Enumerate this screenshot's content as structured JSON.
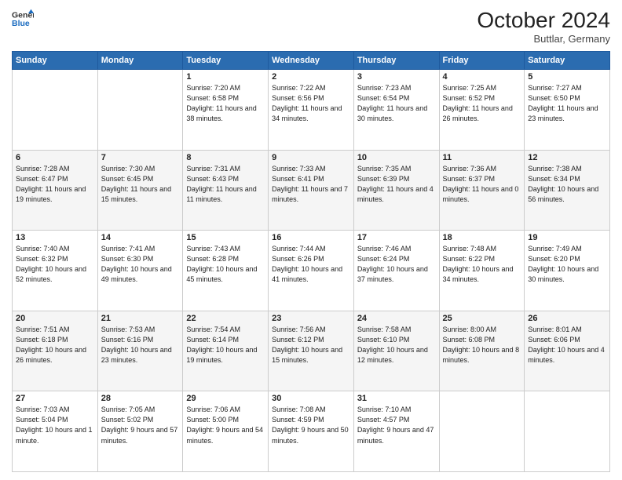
{
  "header": {
    "logo": {
      "general": "General",
      "blue": "Blue"
    },
    "title": "October 2024",
    "location": "Buttlar, Germany"
  },
  "calendar": {
    "days_of_week": [
      "Sunday",
      "Monday",
      "Tuesday",
      "Wednesday",
      "Thursday",
      "Friday",
      "Saturday"
    ],
    "weeks": [
      [
        {
          "day": "",
          "sunrise": "",
          "sunset": "",
          "daylight": ""
        },
        {
          "day": "",
          "sunrise": "",
          "sunset": "",
          "daylight": ""
        },
        {
          "day": "1",
          "sunrise": "Sunrise: 7:20 AM",
          "sunset": "Sunset: 6:58 PM",
          "daylight": "Daylight: 11 hours and 38 minutes."
        },
        {
          "day": "2",
          "sunrise": "Sunrise: 7:22 AM",
          "sunset": "Sunset: 6:56 PM",
          "daylight": "Daylight: 11 hours and 34 minutes."
        },
        {
          "day": "3",
          "sunrise": "Sunrise: 7:23 AM",
          "sunset": "Sunset: 6:54 PM",
          "daylight": "Daylight: 11 hours and 30 minutes."
        },
        {
          "day": "4",
          "sunrise": "Sunrise: 7:25 AM",
          "sunset": "Sunset: 6:52 PM",
          "daylight": "Daylight: 11 hours and 26 minutes."
        },
        {
          "day": "5",
          "sunrise": "Sunrise: 7:27 AM",
          "sunset": "Sunset: 6:50 PM",
          "daylight": "Daylight: 11 hours and 23 minutes."
        }
      ],
      [
        {
          "day": "6",
          "sunrise": "Sunrise: 7:28 AM",
          "sunset": "Sunset: 6:47 PM",
          "daylight": "Daylight: 11 hours and 19 minutes."
        },
        {
          "day": "7",
          "sunrise": "Sunrise: 7:30 AM",
          "sunset": "Sunset: 6:45 PM",
          "daylight": "Daylight: 11 hours and 15 minutes."
        },
        {
          "day": "8",
          "sunrise": "Sunrise: 7:31 AM",
          "sunset": "Sunset: 6:43 PM",
          "daylight": "Daylight: 11 hours and 11 minutes."
        },
        {
          "day": "9",
          "sunrise": "Sunrise: 7:33 AM",
          "sunset": "Sunset: 6:41 PM",
          "daylight": "Daylight: 11 hours and 7 minutes."
        },
        {
          "day": "10",
          "sunrise": "Sunrise: 7:35 AM",
          "sunset": "Sunset: 6:39 PM",
          "daylight": "Daylight: 11 hours and 4 minutes."
        },
        {
          "day": "11",
          "sunrise": "Sunrise: 7:36 AM",
          "sunset": "Sunset: 6:37 PM",
          "daylight": "Daylight: 11 hours and 0 minutes."
        },
        {
          "day": "12",
          "sunrise": "Sunrise: 7:38 AM",
          "sunset": "Sunset: 6:34 PM",
          "daylight": "Daylight: 10 hours and 56 minutes."
        }
      ],
      [
        {
          "day": "13",
          "sunrise": "Sunrise: 7:40 AM",
          "sunset": "Sunset: 6:32 PM",
          "daylight": "Daylight: 10 hours and 52 minutes."
        },
        {
          "day": "14",
          "sunrise": "Sunrise: 7:41 AM",
          "sunset": "Sunset: 6:30 PM",
          "daylight": "Daylight: 10 hours and 49 minutes."
        },
        {
          "day": "15",
          "sunrise": "Sunrise: 7:43 AM",
          "sunset": "Sunset: 6:28 PM",
          "daylight": "Daylight: 10 hours and 45 minutes."
        },
        {
          "day": "16",
          "sunrise": "Sunrise: 7:44 AM",
          "sunset": "Sunset: 6:26 PM",
          "daylight": "Daylight: 10 hours and 41 minutes."
        },
        {
          "day": "17",
          "sunrise": "Sunrise: 7:46 AM",
          "sunset": "Sunset: 6:24 PM",
          "daylight": "Daylight: 10 hours and 37 minutes."
        },
        {
          "day": "18",
          "sunrise": "Sunrise: 7:48 AM",
          "sunset": "Sunset: 6:22 PM",
          "daylight": "Daylight: 10 hours and 34 minutes."
        },
        {
          "day": "19",
          "sunrise": "Sunrise: 7:49 AM",
          "sunset": "Sunset: 6:20 PM",
          "daylight": "Daylight: 10 hours and 30 minutes."
        }
      ],
      [
        {
          "day": "20",
          "sunrise": "Sunrise: 7:51 AM",
          "sunset": "Sunset: 6:18 PM",
          "daylight": "Daylight: 10 hours and 26 minutes."
        },
        {
          "day": "21",
          "sunrise": "Sunrise: 7:53 AM",
          "sunset": "Sunset: 6:16 PM",
          "daylight": "Daylight: 10 hours and 23 minutes."
        },
        {
          "day": "22",
          "sunrise": "Sunrise: 7:54 AM",
          "sunset": "Sunset: 6:14 PM",
          "daylight": "Daylight: 10 hours and 19 minutes."
        },
        {
          "day": "23",
          "sunrise": "Sunrise: 7:56 AM",
          "sunset": "Sunset: 6:12 PM",
          "daylight": "Daylight: 10 hours and 15 minutes."
        },
        {
          "day": "24",
          "sunrise": "Sunrise: 7:58 AM",
          "sunset": "Sunset: 6:10 PM",
          "daylight": "Daylight: 10 hours and 12 minutes."
        },
        {
          "day": "25",
          "sunrise": "Sunrise: 8:00 AM",
          "sunset": "Sunset: 6:08 PM",
          "daylight": "Daylight: 10 hours and 8 minutes."
        },
        {
          "day": "26",
          "sunrise": "Sunrise: 8:01 AM",
          "sunset": "Sunset: 6:06 PM",
          "daylight": "Daylight: 10 hours and 4 minutes."
        }
      ],
      [
        {
          "day": "27",
          "sunrise": "Sunrise: 7:03 AM",
          "sunset": "Sunset: 5:04 PM",
          "daylight": "Daylight: 10 hours and 1 minute."
        },
        {
          "day": "28",
          "sunrise": "Sunrise: 7:05 AM",
          "sunset": "Sunset: 5:02 PM",
          "daylight": "Daylight: 9 hours and 57 minutes."
        },
        {
          "day": "29",
          "sunrise": "Sunrise: 7:06 AM",
          "sunset": "Sunset: 5:00 PM",
          "daylight": "Daylight: 9 hours and 54 minutes."
        },
        {
          "day": "30",
          "sunrise": "Sunrise: 7:08 AM",
          "sunset": "Sunset: 4:59 PM",
          "daylight": "Daylight: 9 hours and 50 minutes."
        },
        {
          "day": "31",
          "sunrise": "Sunrise: 7:10 AM",
          "sunset": "Sunset: 4:57 PM",
          "daylight": "Daylight: 9 hours and 47 minutes."
        },
        {
          "day": "",
          "sunrise": "",
          "sunset": "",
          "daylight": ""
        },
        {
          "day": "",
          "sunrise": "",
          "sunset": "",
          "daylight": ""
        }
      ]
    ]
  }
}
